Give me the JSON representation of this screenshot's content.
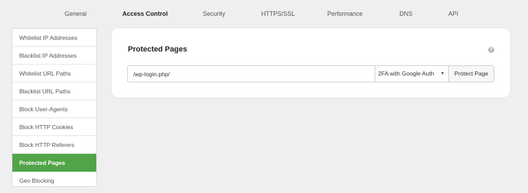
{
  "top_tabs": [
    {
      "label": "General"
    },
    {
      "label": "Access Control"
    },
    {
      "label": "Security"
    },
    {
      "label": "HTTPS/SSL"
    },
    {
      "label": "Performance"
    },
    {
      "label": "DNS"
    },
    {
      "label": "API"
    }
  ],
  "sidebar": {
    "items": [
      {
        "label": "Whitelist IP Addresses"
      },
      {
        "label": "Blacklist IP Addresses"
      },
      {
        "label": "Whitelist URL Paths"
      },
      {
        "label": "Blacklist URL Paths"
      },
      {
        "label": "Block User-Agents"
      },
      {
        "label": "Block HTTP Cookies"
      },
      {
        "label": "Block HTTP Referers"
      },
      {
        "label": "Protected Pages"
      },
      {
        "label": "Geo Blocking"
      }
    ]
  },
  "card": {
    "title": "Protected Pages",
    "help_icon": "?",
    "path_value": "/wp-login.php/",
    "auth_selected": "2FA with Google Auth",
    "protect_button": "Protect Page"
  },
  "colors": {
    "accent": "#51a447"
  },
  "icons": {
    "help": "question-circle-icon",
    "caret": "chevron-down-icon"
  }
}
